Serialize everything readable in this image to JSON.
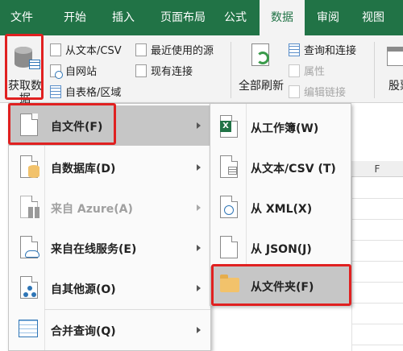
{
  "ribbon_tabs": [
    "文件",
    "开始",
    "插入",
    "页面布局",
    "公式",
    "数据",
    "审阅",
    "视图"
  ],
  "active_tab": "数据",
  "get_data": {
    "label_line1": "获取数",
    "label_line2": "据"
  },
  "get_transform": {
    "from_text_csv": "从文本/CSV",
    "from_web": "自网站",
    "from_table": "自表格/区域",
    "recent_sources": "最近使用的源",
    "existing_connections": "现有连接"
  },
  "queries": {
    "refresh_all": "全部刷新",
    "queries_connections": "查询和连接",
    "properties": "属性",
    "edit_links": "编辑链接"
  },
  "stocks_label": "股票",
  "sheet": {
    "column_f": "F"
  },
  "menu": [
    {
      "label": "自文件(F)",
      "icon": "file-icon",
      "state": "highlighted"
    },
    {
      "label": "自数据库(D)",
      "icon": "database-icon",
      "state": "normal"
    },
    {
      "label": "来自 Azure(A)",
      "icon": "azure-icon",
      "state": "disabled"
    },
    {
      "label": "来自在线服务(E)",
      "icon": "online-service-icon",
      "state": "normal"
    },
    {
      "label": "自其他源(O)",
      "icon": "other-sources-icon",
      "state": "normal"
    },
    {
      "label": "合并查询(Q)",
      "icon": "combine-queries-icon",
      "state": "normal"
    }
  ],
  "submenu": [
    {
      "label": "从工作簿(W)",
      "icon": "excel-workbook-icon"
    },
    {
      "label": "从文本/CSV (T)",
      "icon": "text-csv-icon"
    },
    {
      "label": "从 XML(X)",
      "icon": "xml-icon"
    },
    {
      "label": "从 JSON(J)",
      "icon": "json-icon"
    },
    {
      "label": "从文件夹(F)",
      "icon": "folder-icon"
    }
  ],
  "colors": {
    "excel_green": "#217346",
    "highlight_red": "#e02020",
    "hover_gray": "#c6c6c6"
  }
}
